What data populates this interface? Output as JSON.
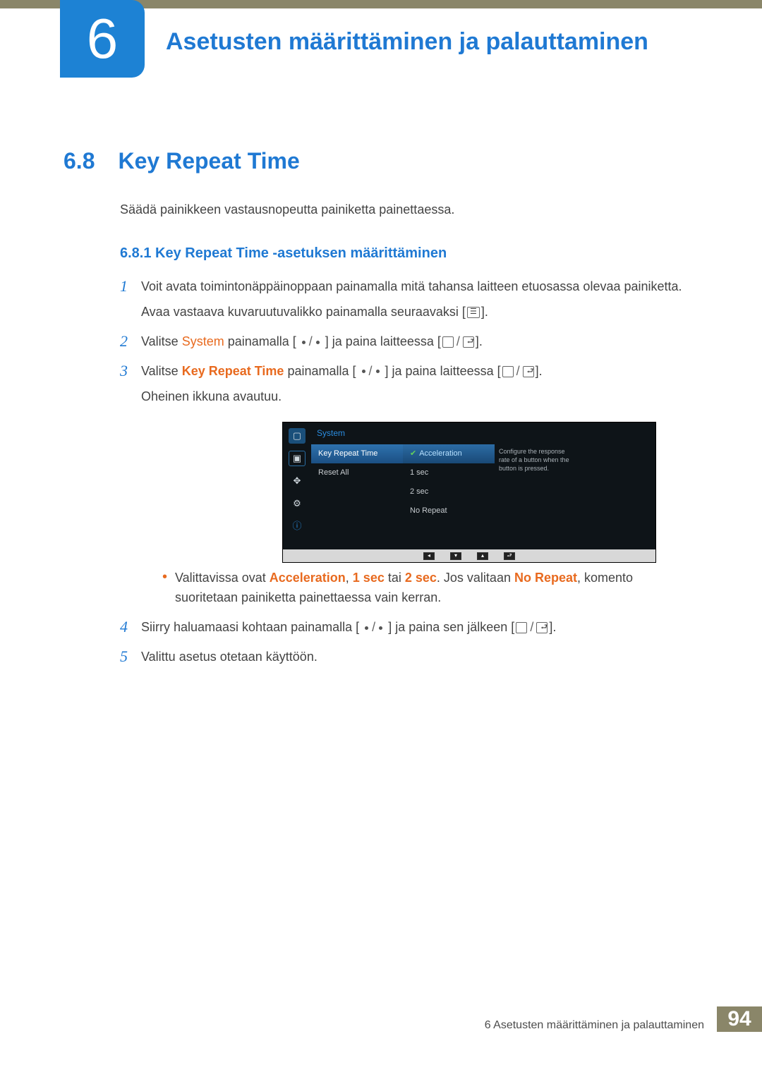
{
  "chapter": {
    "num": "6",
    "title": "Asetusten määrittäminen ja palauttaminen"
  },
  "section": {
    "num": "6.8",
    "title": "Key Repeat Time"
  },
  "intro": "Säädä painikkeen vastausnopeutta painiketta painettaessa.",
  "subsection": "6.8.1  Key Repeat Time -asetuksen määrittäminen",
  "steps": {
    "s1a": "Voit avata toimintonäppäinoppaan painamalla mitä tahansa laitteen etuosassa olevaa painiketta.",
    "s1b_pre": "Avaa vastaava kuvaruutuvalikko painamalla seuraavaksi [",
    "s1b_post": "].",
    "s2_pre": "Valitse ",
    "s2_hl": "System",
    "s2_mid": " painamalla [ ",
    "s2_mid2": " ] ja paina laitteessa [",
    "s2_post": "].",
    "s3_pre": "Valitse ",
    "s3_hl": "Key Repeat Time",
    "s3_mid": " painamalla [ ",
    "s3_mid2": " ] ja paina laitteessa [",
    "s3_post": "].",
    "s3_sub": "Oheinen ikkuna avautuu.",
    "bullet_pre": "Valittavissa ovat ",
    "bullet_a": "Acceleration",
    "bullet_sep1": ", ",
    "bullet_b": "1 sec",
    "bullet_sep2": " tai ",
    "bullet_c": "2 sec",
    "bullet_mid": ". Jos valitaan ",
    "bullet_d": "No Repeat",
    "bullet_post": ", komento suoritetaan painiketta painettaessa vain kerran.",
    "s4_pre": "Siirry haluamaasi kohtaan painamalla [ ",
    "s4_mid": " ] ja paina sen jälkeen [",
    "s4_post": "].",
    "s5": "Valittu asetus otetaan käyttöön."
  },
  "osd": {
    "title": "System",
    "menu": {
      "key_repeat": "Key Repeat Time",
      "reset_all": "Reset All"
    },
    "opts": {
      "accel": "Acceleration",
      "one": "1 sec",
      "two": "2 sec",
      "norep": "No Repeat"
    },
    "desc": "Configure the response rate of a button when the button is pressed."
  },
  "footer": {
    "text": "6 Asetusten määrittäminen ja palauttaminen",
    "page": "94"
  }
}
